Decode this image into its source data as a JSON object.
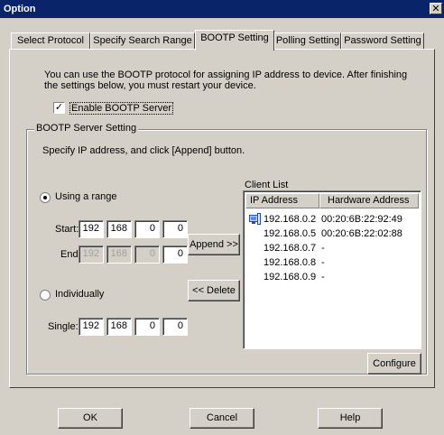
{
  "window": {
    "title": "Option",
    "close_glyph": "✕"
  },
  "tabs": [
    {
      "label": "Select Protocol"
    },
    {
      "label": "Specify Search Range"
    },
    {
      "label": "BOOTP Setting"
    },
    {
      "label": "Polling Setting"
    },
    {
      "label": "Password Setting"
    }
  ],
  "description": {
    "line1": "You can use the BOOTP protocol for assigning IP address to device. After finishing",
    "line2": "the settings below, you must restart your device."
  },
  "enable_bootp": {
    "label": "Enable BOOTP Server",
    "checked": true,
    "check_glyph": "✓"
  },
  "group": {
    "title": "BOOTP Server Setting",
    "instruction": "Specify IP address, and click [Append] button.",
    "range": {
      "label": "Using a range",
      "selected": true,
      "start_label": "Start:",
      "end_label": "End:",
      "start": [
        "192",
        "168",
        "0",
        "0"
      ],
      "end": [
        "192",
        "168",
        "0",
        "0"
      ]
    },
    "individual": {
      "label": "Individually",
      "selected": false,
      "single_label": "Single:",
      "single": [
        "192",
        "168",
        "0",
        "0"
      ]
    },
    "append_label": "Append >>",
    "delete_label": "<< Delete",
    "client_list": {
      "title": "Client List",
      "col_ip": "IP Address",
      "col_hw": "Hardware Address",
      "rows": [
        {
          "ip": "192.168.0.2",
          "hw": "00:20:6B:22:92:49",
          "icon": "device-icon"
        },
        {
          "ip": "192.168.0.5",
          "hw": "00:20:6B:22:02:88"
        },
        {
          "ip": "192.168.0.7",
          "hw": "-"
        },
        {
          "ip": "192.168.0.8",
          "hw": "-"
        },
        {
          "ip": "192.168.0.9",
          "hw": "-"
        }
      ]
    },
    "configure_label": "Configure"
  },
  "footer": {
    "ok_label": "OK",
    "cancel_label": "Cancel",
    "help_label": "Help"
  }
}
